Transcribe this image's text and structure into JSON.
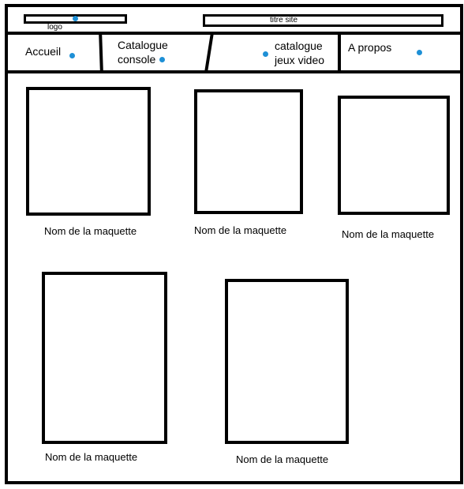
{
  "header": {
    "logo_label": "logo",
    "site_title": "titre site"
  },
  "nav": {
    "items": [
      {
        "label": "Accueil"
      },
      {
        "label_line1": "Catalogue",
        "label_line2": "console"
      },
      {
        "label_line1": "catalogue",
        "label_line2": "jeux video"
      },
      {
        "label": "A propos"
      }
    ]
  },
  "products": [
    {
      "name": "Nom de la maquette"
    },
    {
      "name": "Nom de la maquette"
    },
    {
      "name": "Nom de la maquette"
    },
    {
      "name": "Nom de la maquette"
    },
    {
      "name": "Nom de la maquette"
    }
  ],
  "colors": {
    "stroke": "#000000",
    "marker": "#1e90d6",
    "background": "#ffffff"
  }
}
